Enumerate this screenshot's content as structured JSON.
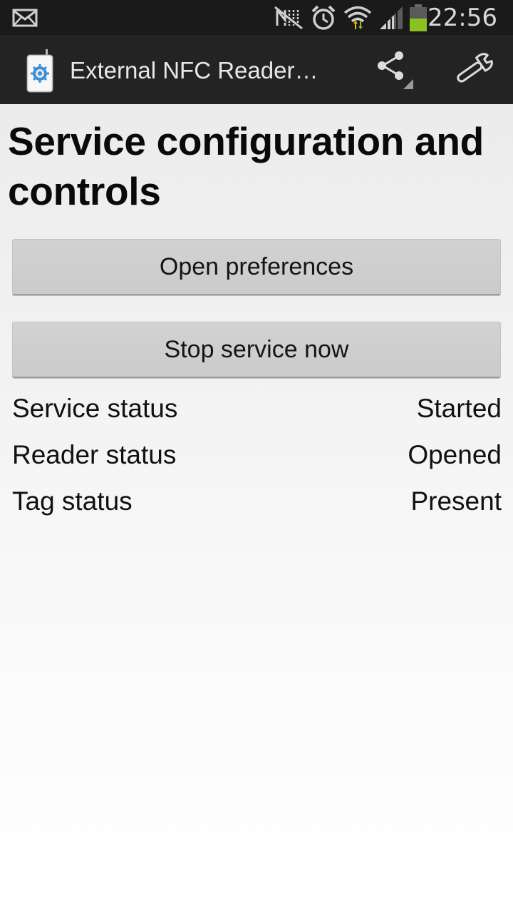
{
  "status_bar": {
    "time": "22:56",
    "icons": [
      "mail-icon",
      "nfc-off-icon",
      "alarm-icon",
      "wifi-icon",
      "signal-icon",
      "battery-icon"
    ],
    "battery_color": "#8cc21f"
  },
  "action_bar": {
    "app_icon": "nfc-reader-app-icon",
    "title": "External NFC Reader…",
    "share_icon": "share-icon",
    "settings_icon": "wrench-icon"
  },
  "main": {
    "title": "Service configuration and controls",
    "buttons": {
      "open_preferences": "Open preferences",
      "stop_service": "Stop service now"
    },
    "status": [
      {
        "label": "Service status",
        "value": "Started"
      },
      {
        "label": "Reader status",
        "value": "Opened"
      },
      {
        "label": "Tag status",
        "value": "Present"
      }
    ]
  }
}
